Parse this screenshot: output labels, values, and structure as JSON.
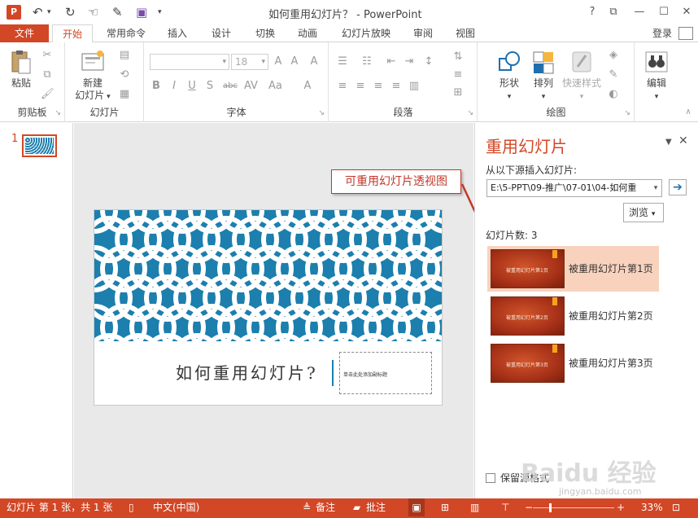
{
  "title_bar": {
    "window_title": "如何重用幻灯片？ - PowerPoint",
    "app_logo_text": "P",
    "qat": [
      "undo-icon",
      "redo-icon",
      "touch-mode-icon",
      "save-icon",
      "customize-icon"
    ],
    "controls": [
      "?",
      "⧉",
      "—",
      "☐",
      "✕"
    ]
  },
  "tabs": {
    "file": "文件",
    "items": [
      "开始",
      "常用命令",
      "插入",
      "设计",
      "切换",
      "动画",
      "幻灯片放映",
      "审阅",
      "视图"
    ],
    "active": "开始",
    "login": "登录"
  },
  "ribbon": {
    "clipboard": {
      "label": "剪贴板",
      "paste": "粘贴"
    },
    "slides": {
      "label": "幻灯片",
      "new_slide_line1": "新建",
      "new_slide_line2": "幻灯片"
    },
    "font": {
      "label": "字体",
      "font_size": "18"
    },
    "paragraph": {
      "label": "段落"
    },
    "drawing": {
      "label": "绘图",
      "shapes": "形状",
      "arrange": "排列",
      "quick_styles": "快速样式"
    },
    "editing": {
      "label": "编辑"
    }
  },
  "thumbnails": {
    "number": "1"
  },
  "slide": {
    "title": "如何重用幻灯片?",
    "subtitle": "单击此处添加副标题"
  },
  "callout": {
    "text": "可重用幻灯片透视图"
  },
  "reuse_pane": {
    "title": "重用幻灯片",
    "source_label": "从以下源插入幻灯片:",
    "source_path": "E:\\5-PPT\\09-推广\\07-01\\04-如何重",
    "browse": "浏览",
    "count_label": "幻灯片数: 3",
    "items": [
      {
        "label": "被重用幻灯片第1页",
        "thumb_text": "被重用幻灯片第1页",
        "selected": true
      },
      {
        "label": "被重用幻灯片第2页",
        "thumb_text": "被重用幻灯片第2页",
        "selected": false
      },
      {
        "label": "被重用幻灯片第3页",
        "thumb_text": "被重用幻灯片第3页",
        "selected": false
      }
    ],
    "keep_format": "保留源格式"
  },
  "status_bar": {
    "slide_info": "幻灯片 第 1 张，共 1 张",
    "language": "中文(中国)",
    "notes": "备注",
    "comments": "批注",
    "zoom": "33%"
  },
  "watermark": {
    "text": "Baidu 经验",
    "url": "jingyan.baidu.com"
  },
  "colors": {
    "accent": "#d24726",
    "pattern_blue": "#1c7fae",
    "selected_item": "#f8d2bd"
  }
}
